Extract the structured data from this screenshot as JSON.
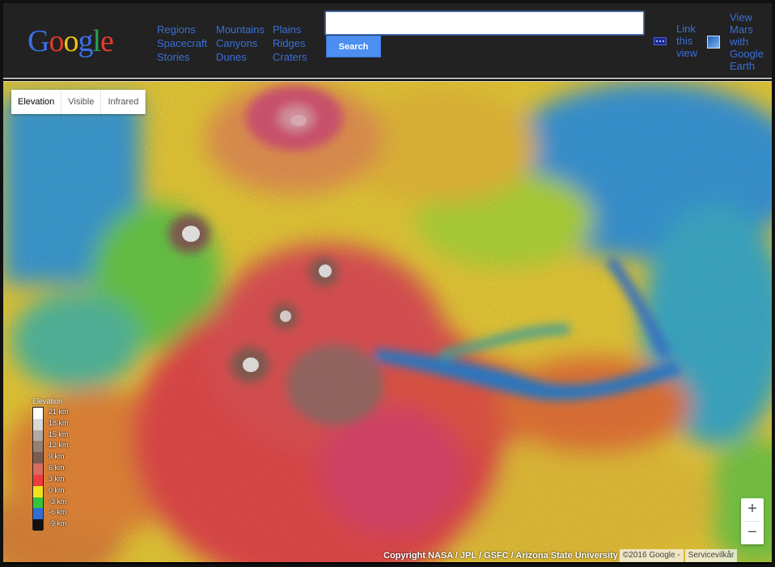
{
  "header": {
    "logo_letters": [
      {
        "ch": "G",
        "color": "#3b6fe6"
      },
      {
        "ch": "o",
        "color": "#e33a2c"
      },
      {
        "ch": "o",
        "color": "#f4c20d"
      },
      {
        "ch": "g",
        "color": "#3b6fe6"
      },
      {
        "ch": "l",
        "color": "#2aa14f"
      },
      {
        "ch": "e",
        "color": "#e33a2c"
      }
    ],
    "nav_col1": [
      "Regions",
      "Spacecraft",
      "Stories"
    ],
    "nav_col2": [
      "Mountains",
      "Canyons",
      "Dunes"
    ],
    "nav_col3": [
      "Plains",
      "Ridges",
      "Craters"
    ],
    "search": {
      "value": "",
      "button_label": "Search"
    },
    "link_view_label": "Link this view",
    "earth_label": "View Mars with Google Earth"
  },
  "map": {
    "tabs": [
      {
        "label": "Elevation",
        "active": true
      },
      {
        "label": "Visible",
        "active": false
      },
      {
        "label": "Infrared",
        "active": false
      }
    ],
    "legend": {
      "title": "Elevation",
      "entries": [
        "21 km",
        "18 km",
        "15 km",
        "12 km",
        "9 km",
        "6 km",
        "3 km",
        "0 km",
        "-3 km",
        "-6 km",
        "-9 km"
      ],
      "colors": [
        "#ffffff",
        "#d9d9d9",
        "#b3a9a4",
        "#948077",
        "#7b5e52",
        "#d76b61",
        "#ef3b3b",
        "#f0e21d",
        "#35c43a",
        "#2f6fd6",
        "#111111"
      ]
    },
    "zoom": {
      "in": "+",
      "out": "−"
    },
    "footer": {
      "copyright": "Copyright NASA / JPL / GSFC / Arizona State University",
      "google": "©2016 Google -",
      "terms": "Servicevilkår"
    }
  }
}
